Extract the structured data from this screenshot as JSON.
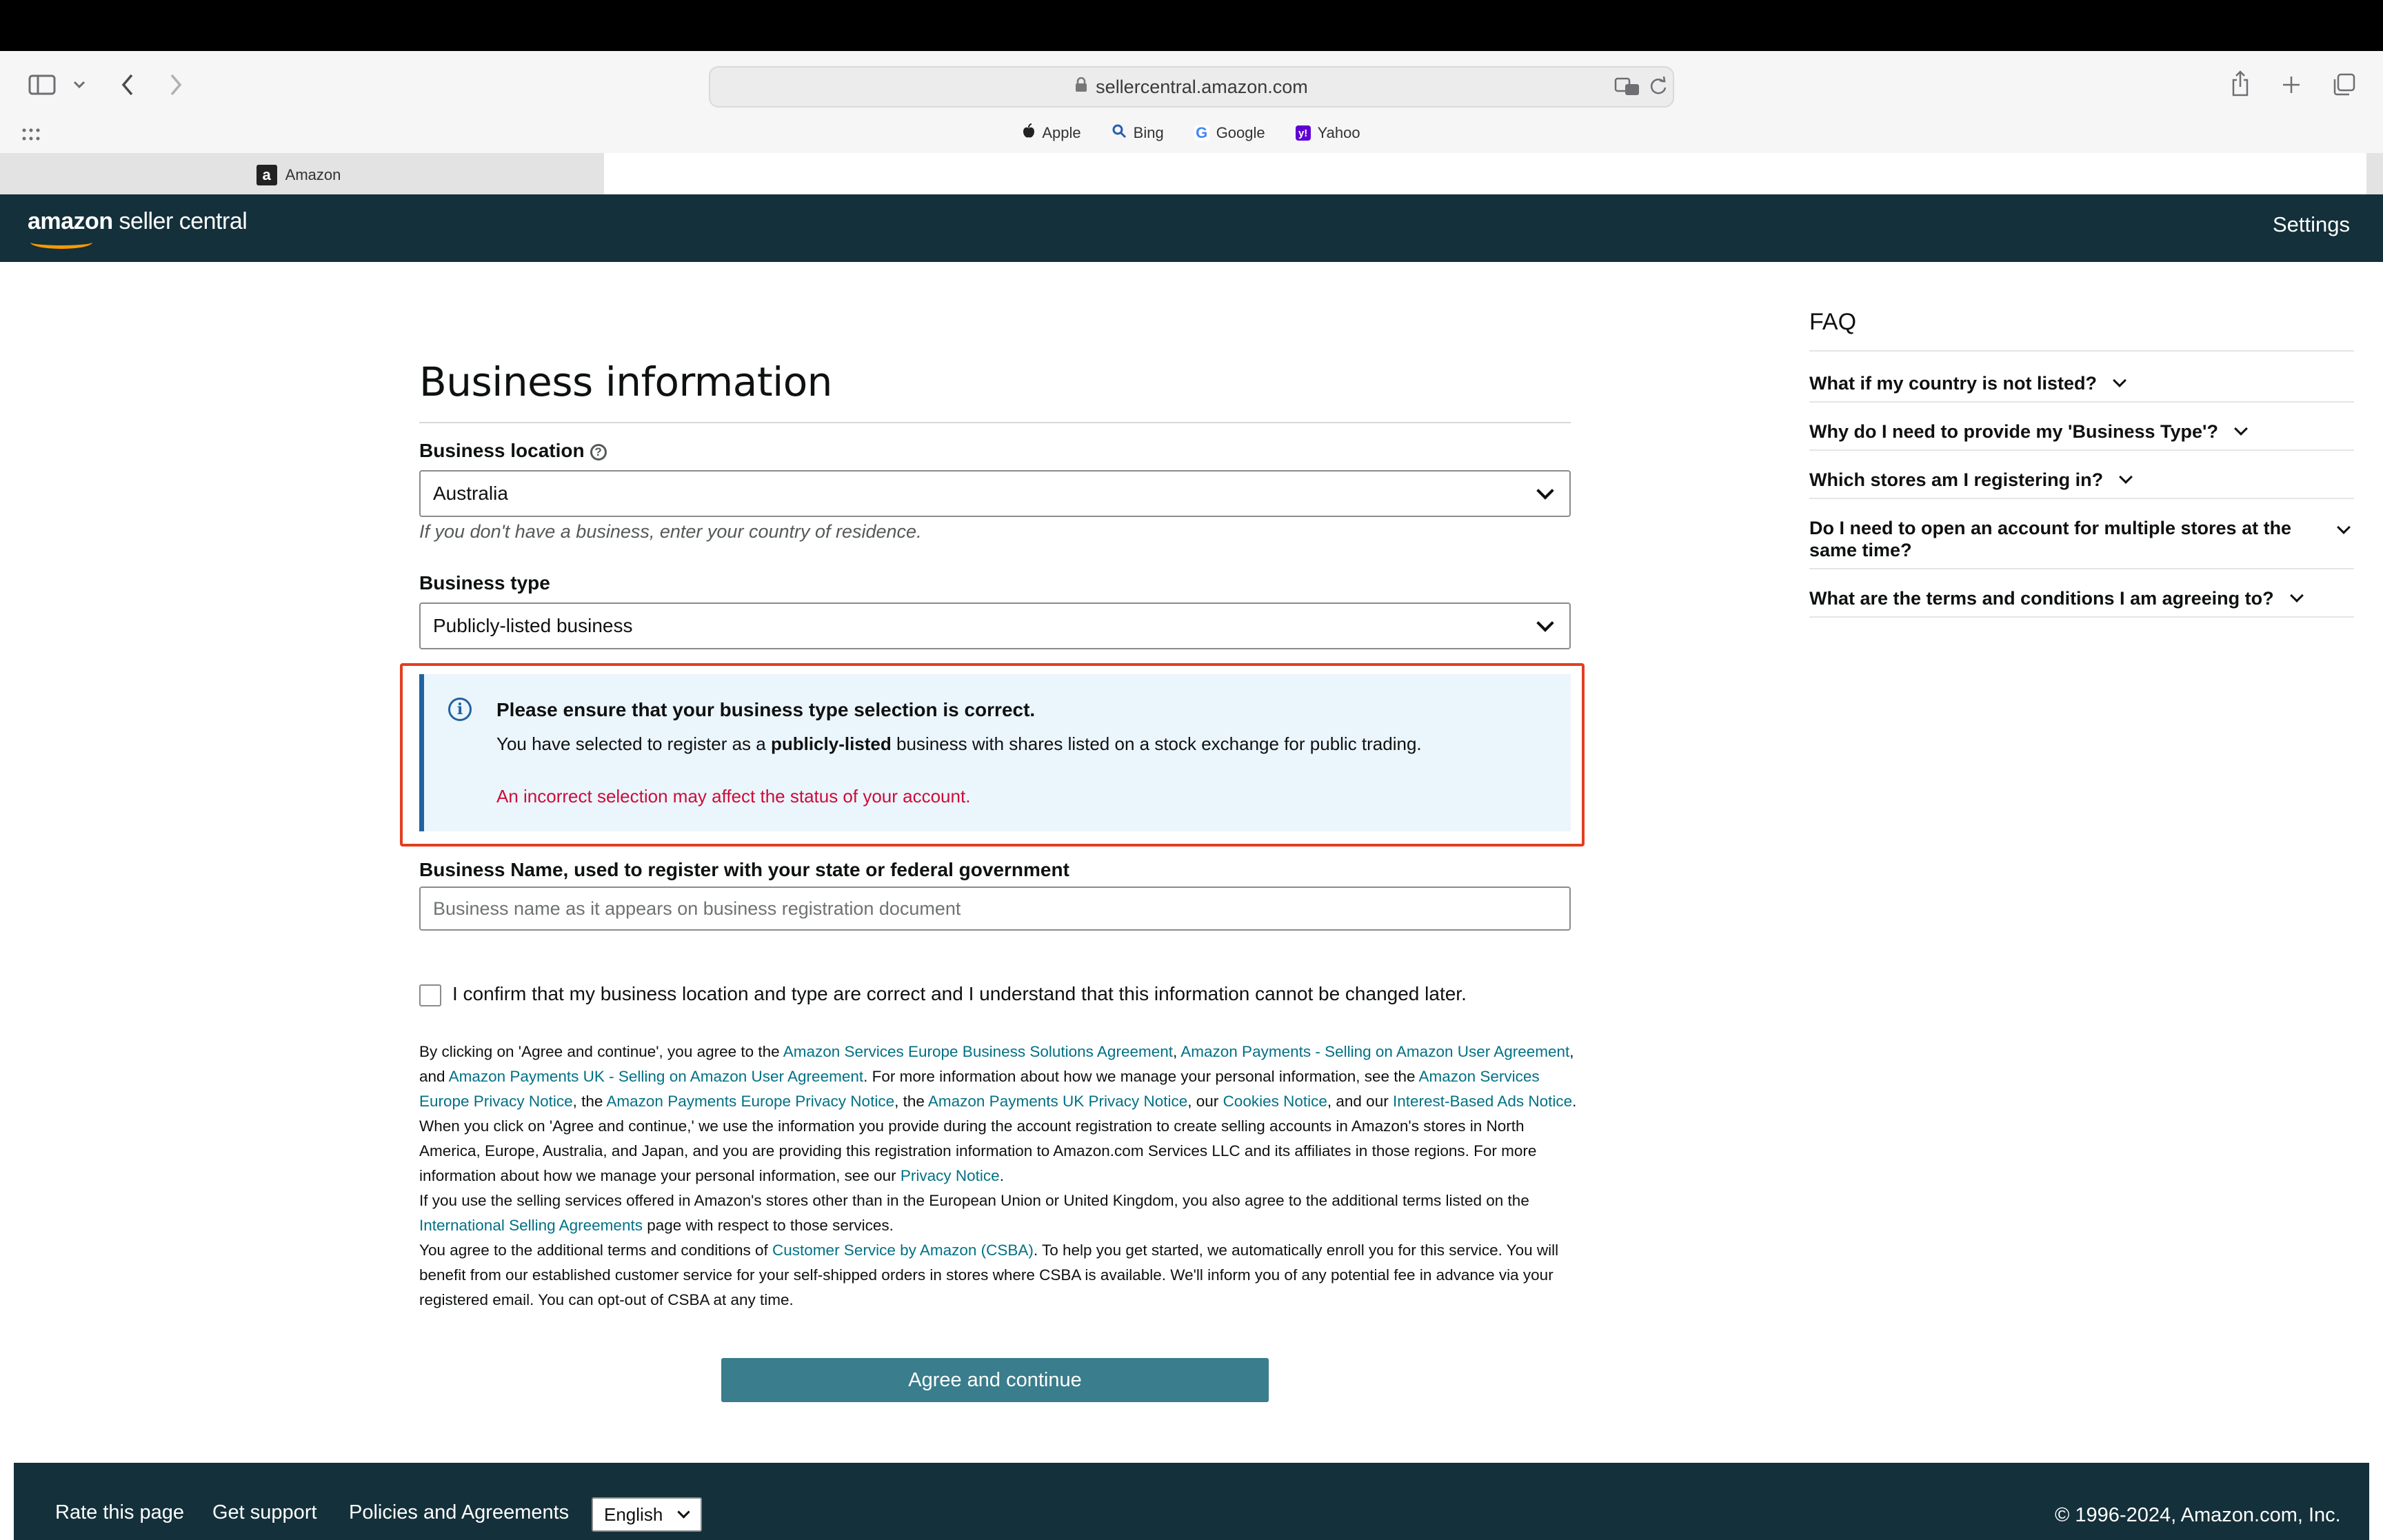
{
  "browser": {
    "url": "sellercentral.amazon.com",
    "favorites": [
      {
        "label": "Apple",
        "icon": "apple-icon"
      },
      {
        "label": "Bing",
        "icon": "search-icon"
      },
      {
        "label": "Google",
        "icon": "google-icon"
      },
      {
        "label": "Yahoo",
        "icon": "yahoo-icon"
      }
    ],
    "tab_title": "Amazon"
  },
  "header": {
    "logo_bold": "amazon",
    "logo_thin": " seller central",
    "settings": "Settings"
  },
  "form": {
    "title": "Business information",
    "location_label": "Business location",
    "location_value": "Australia",
    "location_hint": "If you don't have a business, enter your country of residence.",
    "type_label": "Business type",
    "type_value": "Publicly-listed business",
    "alert": {
      "title": "Please ensure that your business type selection is correct.",
      "body_pre": "You have selected to register as a ",
      "body_bold": "publicly-listed",
      "body_post": " business with shares listed on a stock exchange for public trading.",
      "warning": "An incorrect selection may affect the status of your account."
    },
    "name_label": "Business Name, used to register with your state or federal government",
    "name_placeholder": "Business name as it appears on business registration document",
    "confirm_label": "I confirm that my business location and type are correct and I understand that this information cannot be changed later.",
    "agree_button": "Agree and continue"
  },
  "legal": {
    "p1_a": "By clicking on 'Agree and continue', you agree to the ",
    "link_esbsa": "Amazon Services Europe Business Solutions Agreement",
    "p1_b": ", ",
    "link_apsua": "Amazon Payments - Selling on Amazon User Agreement",
    "p1_c": ", and ",
    "link_apuk": "Amazon Payments UK - Selling on Amazon User Agreement",
    "p1_d": ". For more information about how we manage your personal information, see the ",
    "link_asepn": "Amazon Services Europe Privacy Notice",
    "p1_e": ", the ",
    "link_apepn": "Amazon Payments Europe Privacy Notice",
    "p1_f": ", the ",
    "link_apukpn": "Amazon Payments UK Privacy Notice",
    "p1_g": ", our ",
    "link_cookies": "Cookies Notice",
    "p1_h": ", and our ",
    "link_iba": "Interest-Based Ads Notice",
    "p1_i": ".",
    "p2_a": "When you click on 'Agree and continue,' we use the information you provide during the account registration to create selling accounts in Amazon's stores in North America, Europe, Australia, and Japan, and you are providing this registration information to Amazon.com Services LLC and its affiliates in those regions. For more information about how we manage your personal information, see our ",
    "link_privacy": "Privacy Notice",
    "p2_b": ".",
    "p3_a": "If you use the selling services offered in Amazon's stores other than in the European Union or United Kingdom, you also agree to the additional terms listed on the ",
    "link_isa": "International Selling Agreements",
    "p3_b": " page with respect to those services.",
    "p4_a": "You agree to the additional terms and conditions of ",
    "link_csba": "Customer Service by Amazon (CSBA)",
    "p4_b": ". To help you get started, we automatically enroll you for this service. You will benefit from our established customer service for your self-shipped orders in stores where CSBA is available. We'll inform you of any potential fee in advance via your registered email. You can opt-out of CSBA at any time."
  },
  "faq": {
    "title": "FAQ",
    "items": [
      "What if my country is not listed?",
      "Why do I need to provide my 'Business Type'?",
      "Which stores am I registering in?",
      "Do I need to open an account for multiple stores at the same time?",
      "What are the terms and conditions I am agreeing to?"
    ]
  },
  "footer": {
    "rate": "Rate this page",
    "support": "Get support",
    "policies": "Policies and Agreements",
    "language": "English",
    "copyright": "© 1996-2024, Amazon.com, Inc."
  },
  "colors": {
    "header_bg": "#14303a",
    "link": "#007185",
    "alert_border": "#e23e20",
    "alert_bg": "#ebf5fc",
    "warning": "#cc0c39",
    "button": "#3a7d8c"
  }
}
